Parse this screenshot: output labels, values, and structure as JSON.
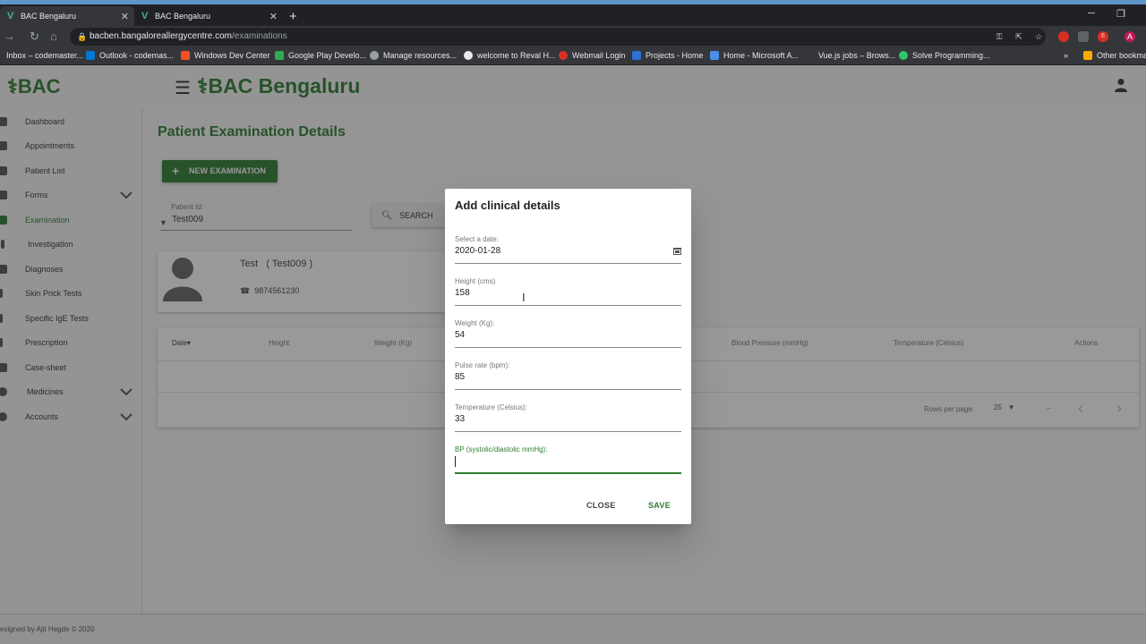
{
  "browser": {
    "tabs": [
      {
        "title": "BAC Bengaluru",
        "active": true
      },
      {
        "title": "BAC Bengaluru",
        "active": false
      }
    ],
    "url_host": "bacben.bangaloreallergycentre.com",
    "url_path": "/examinations",
    "bookmarks": [
      "Inbox – codemaster...",
      "Outlook - codemas...",
      "Windows Dev Center",
      "Google Play Develo...",
      "Manage resources...",
      "welcome to Reval H...",
      "Webmail Login",
      "Projects - Home",
      "Home - Microsoft A...",
      "Vue.js jobs – Brows...",
      "Solve Programming...",
      "Other bookma"
    ],
    "profile_initial": "A",
    "ext_badge": "6"
  },
  "header": {
    "logo_text": "BAC",
    "brand_text": "BAC Bengaluru"
  },
  "sidebar": {
    "items": [
      {
        "label": "Dashboard"
      },
      {
        "label": "Appointments"
      },
      {
        "label": "Patient List"
      },
      {
        "label": "Forms"
      },
      {
        "label": "Examination"
      },
      {
        "label": "Investigation"
      },
      {
        "label": "Diagnoses"
      },
      {
        "label": "Skin Prick Tests"
      },
      {
        "label": "Specific IgE Tests"
      },
      {
        "label": "Prescription"
      },
      {
        "label": "Case-sheet"
      },
      {
        "label": "Medicines"
      },
      {
        "label": "Accounts"
      }
    ]
  },
  "page": {
    "title": "Patient Examination Details",
    "new_button": "NEW EXAMINATION",
    "patient_id_label": "Patient Id:",
    "patient_id_value": "Test009",
    "search_button": "SEARCH"
  },
  "patient": {
    "name": "Test",
    "id_paren": "( Test009 )",
    "phone": "9874561230"
  },
  "table": {
    "columns": [
      "Date",
      "Height",
      "Weight (Kg)",
      "Blood Pressure (mmHg)",
      "Temperature (Celsius)",
      "Actions"
    ],
    "rows_per_page_label": "Rows per page:",
    "rows_per_page_value": "25",
    "range_text": "–"
  },
  "footer": {
    "text": "esigned by Ajit Hegde © 2020"
  },
  "dialog": {
    "title": "Add clinical details",
    "fields": [
      {
        "label": "Select a date:",
        "value": "2020-01-28"
      },
      {
        "label": "Height (cms)",
        "value": "158"
      },
      {
        "label": "Weight (Kg):",
        "value": "54"
      },
      {
        "label": "Pulse rate (bpm):",
        "value": "85"
      },
      {
        "label": "Temperature (Celsius):",
        "value": "33"
      },
      {
        "label": "BP (systolic/diastolic mmHg):",
        "value": ""
      }
    ],
    "close_label": "CLOSE",
    "save_label": "SAVE"
  },
  "colors": {
    "brand_green": "#2e7d32",
    "browser_dark": "#202124",
    "overlay": "rgba(33,33,33,0.46)"
  }
}
